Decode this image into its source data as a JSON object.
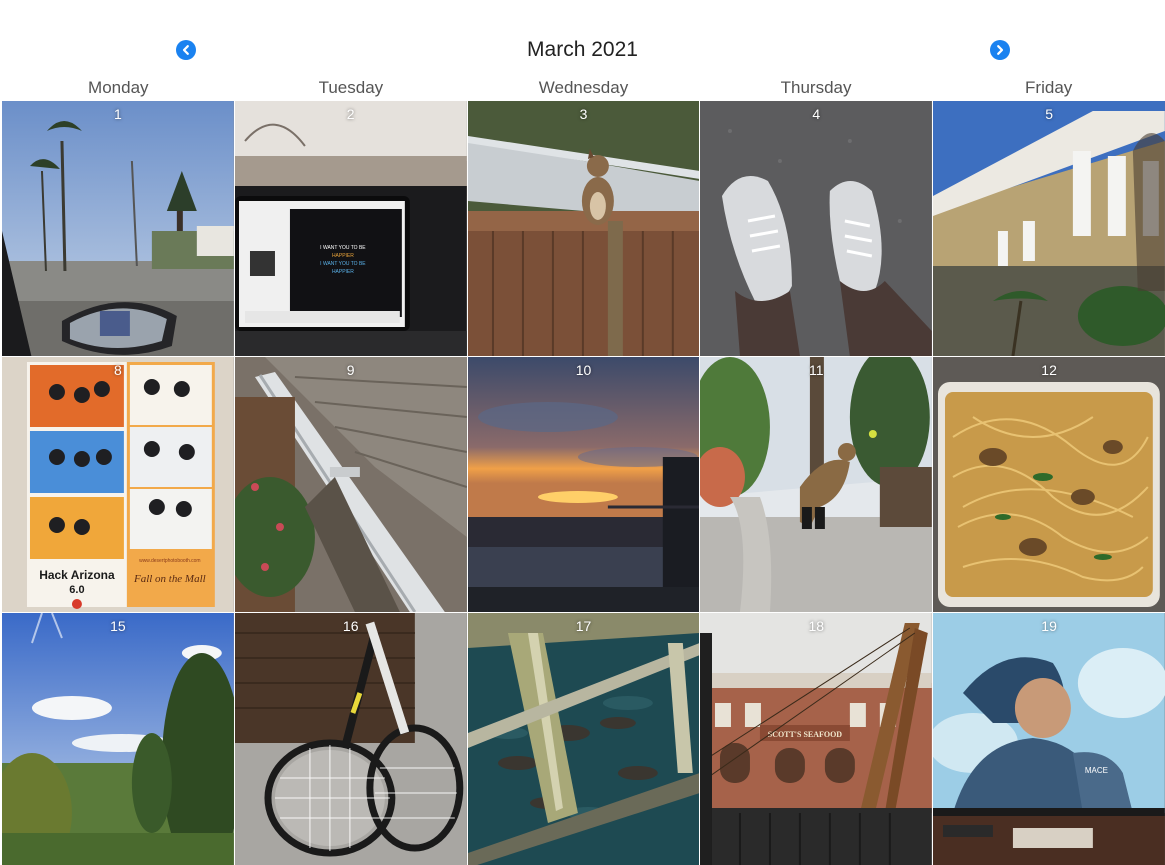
{
  "calendar": {
    "month_title": "March 2021",
    "prev_icon": "chevron-left-icon",
    "next_icon": "chevron-right-icon",
    "accent_color": "#1a82f0",
    "weekdays": [
      "Monday",
      "Tuesday",
      "Wednesday",
      "Thursday",
      "Friday"
    ],
    "days": [
      {
        "number": "1",
        "photo": "street-view-from-car-photo"
      },
      {
        "number": "2",
        "photo": "car-dashboard-screen-photo"
      },
      {
        "number": "3",
        "photo": "squirrel-on-fence-photo"
      },
      {
        "number": "4",
        "photo": "sneakers-on-asphalt-photo"
      },
      {
        "number": "5",
        "photo": "building-with-palms-photo"
      },
      {
        "number": "8",
        "photo": "photo-booth-strips-photo"
      },
      {
        "number": "9",
        "photo": "roof-gutter-photo"
      },
      {
        "number": "10",
        "photo": "sunset-over-water-photo"
      },
      {
        "number": "11",
        "photo": "dog-catching-ball-photo"
      },
      {
        "number": "12",
        "photo": "spaghetti-container-photo"
      },
      {
        "number": "15",
        "photo": "valley-hillside-photo"
      },
      {
        "number": "16",
        "photo": "tennis-rackets-photo"
      },
      {
        "number": "17",
        "photo": "sea-lions-under-pier-photo"
      },
      {
        "number": "18",
        "photo": "scotts-seafood-bridge-photo"
      },
      {
        "number": "19",
        "photo": "tv-soldier-screen-photo"
      }
    ],
    "photo_text": {
      "screen_line_1": "I WANT YOU TO BE",
      "screen_line_2": "HAPPIER",
      "screen_line_3": "I WANT YOU TO BE",
      "screen_line_4": "HAPPIER",
      "hack_arizona": "Hack Arizona",
      "hack_version": "6.0",
      "fall_mall": "Fall on the Mall",
      "booth_url": "www.desertphotobooth.com",
      "scotts_sign": "SCOTT'S SEAFOOD",
      "tv_brand": "MACE"
    }
  }
}
